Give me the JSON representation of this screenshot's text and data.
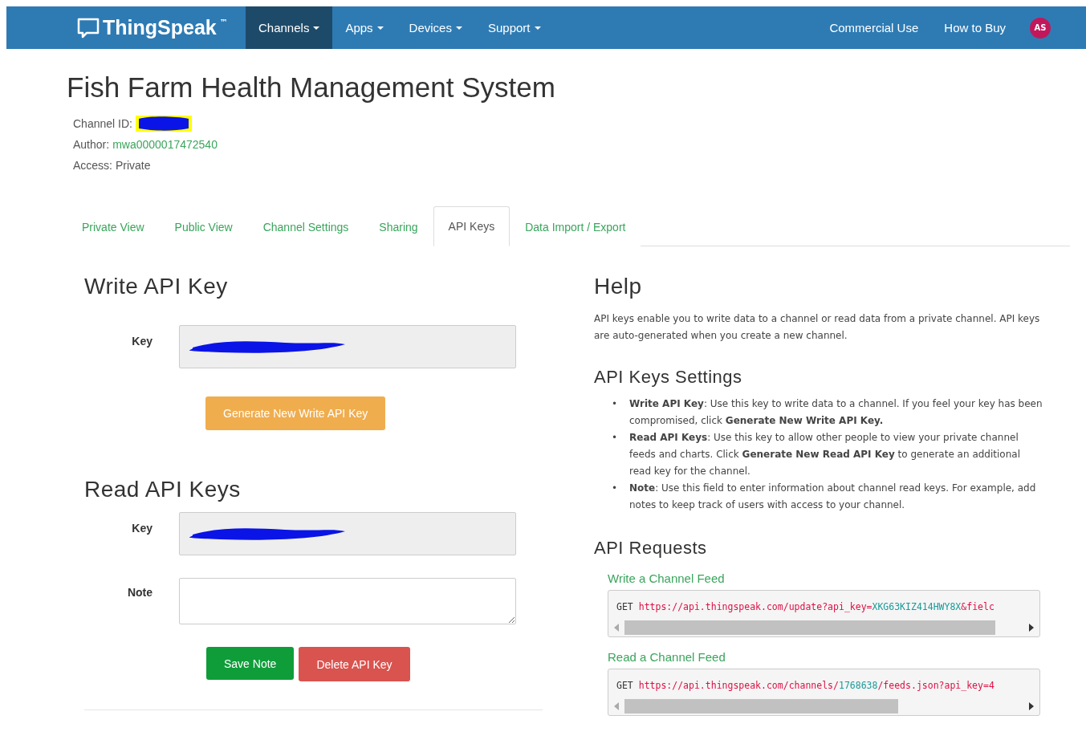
{
  "nav": {
    "logo": "ThingSpeak",
    "trademark": "™",
    "items": [
      {
        "label": "Channels",
        "selected": true,
        "dropdown": true
      },
      {
        "label": "Apps",
        "selected": false,
        "dropdown": true
      },
      {
        "label": "Devices",
        "selected": false,
        "dropdown": true
      },
      {
        "label": "Support",
        "selected": false,
        "dropdown": true
      }
    ],
    "right_links": [
      "Commercial Use",
      "How to Buy"
    ],
    "avatar": "AS"
  },
  "channel": {
    "title": "Fish Farm Health Management System",
    "id_label": "Channel ID:",
    "author_label": "Author:",
    "author": "mwa0000017472540",
    "access": "Access: Private"
  },
  "tabs": [
    {
      "label": "Private View",
      "selected": false
    },
    {
      "label": "Public View",
      "selected": false
    },
    {
      "label": "Channel Settings",
      "selected": false
    },
    {
      "label": "Sharing",
      "selected": false
    },
    {
      "label": "API Keys",
      "selected": true
    },
    {
      "label": "Data Import / Export",
      "selected": false
    }
  ],
  "write_key": {
    "heading": "Write API Key",
    "key_label": "Key",
    "button": "Generate New Write API Key"
  },
  "read_keys": {
    "heading": "Read API Keys",
    "key_label": "Key",
    "note_label": "Note",
    "save_button": "Save Note",
    "delete_button": "Delete API Key"
  },
  "help": {
    "heading": "Help",
    "intro": "API keys enable you to write data to a channel or read data from a private channel. API keys are auto-generated when you create a new channel.",
    "settings_heading": "API Keys Settings",
    "settings_items": [
      {
        "bullet": "•",
        "text": "**Write API Key**: Use this key to write data to a channel. If you feel your key has been compromised, click **Generate New Write API Key.**"
      },
      {
        "bullet": "•",
        "text": "**Read API Keys**: Use this key to allow other people to view your private channel feeds and charts. Click **Generate New Read API Key** to generate an additional read key for the channel."
      },
      {
        "bullet": "•",
        "text": "**Note**: Use this field to enter information about channel read keys. For example, add notes to keep track of users with access to your channel."
      }
    ],
    "requests_heading": "API Requests",
    "requests": [
      {
        "title": "Write a Channel Feed",
        "parts": [
          {
            "kind": "verb",
            "text": "GET "
          },
          {
            "kind": "url",
            "text": "https://api.thingspeak.com/update?api_key="
          },
          {
            "kind": "value",
            "text": "XKG63KIZ414HWY8X"
          },
          {
            "kind": "url",
            "text": "&fielc"
          }
        ]
      },
      {
        "title": "Read a Channel Feed",
        "parts": [
          {
            "kind": "verb",
            "text": "GET "
          },
          {
            "kind": "url",
            "text": "https://api.thingspeak.com/channels/"
          },
          {
            "kind": "value",
            "text": "1768638"
          },
          {
            "kind": "url",
            "text": "/feeds.json?api_key=4"
          }
        ]
      }
    ]
  }
}
